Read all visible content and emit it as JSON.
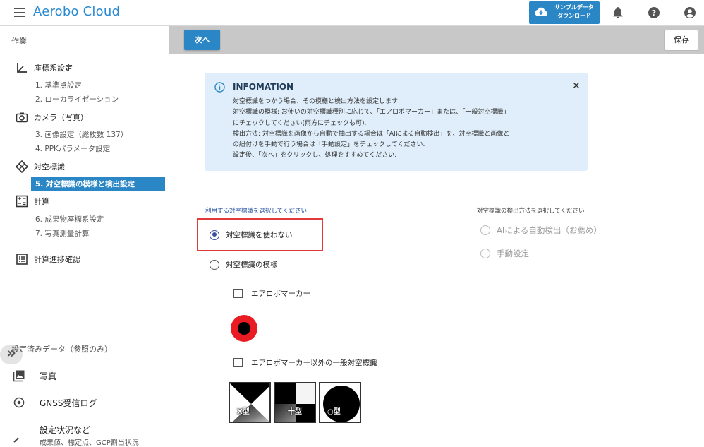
{
  "header": {
    "menu_icon": "hamburger-menu-icon",
    "app_title": "Aerobo Cloud",
    "download_button": {
      "icon": "cloud-download-icon",
      "line1": "サンプルデータ",
      "line2": "ダウンロード"
    },
    "icons": [
      "bell-icon",
      "help-icon",
      "account-icon"
    ],
    "accent_color": "#2b86c5"
  },
  "sidebar": {
    "work_title": "作業",
    "sections": [
      {
        "icon": "axis-icon",
        "label": "座標系設定",
        "items": [
          "1. 基準点設定",
          "2. ローカライゼーション"
        ]
      },
      {
        "icon": "camera-icon",
        "label": "カメラ（写真）",
        "items": [
          "3. 画像設定（総枚数 137）",
          "4. PPKパラメータ設定"
        ]
      },
      {
        "icon": "target-diamond-icon",
        "label": "対空標識",
        "active_item": "5. 対空標識の模様と検出設定"
      },
      {
        "icon": "calculator-icon",
        "label": "計算",
        "items": [
          "6. 成果物座標系設定",
          "7. 写真測量計算"
        ]
      },
      {
        "icon": "list-icon",
        "label": "計算進捗確認"
      }
    ],
    "collapse_label": "»",
    "reference_title": "設定済みデータ（参照のみ）",
    "reference_items": [
      {
        "icon": "photo-icon",
        "label": "写真"
      },
      {
        "icon": "gnss-icon",
        "label": "GNSS受信ログ"
      },
      {
        "icon": "status-icon",
        "label": "設定状況など",
        "sub": "成果値、標定点、GCP割当状況"
      }
    ]
  },
  "toolbar": {
    "next_label": "次へ",
    "save_label": "保存"
  },
  "info": {
    "icon": "info-icon",
    "title": "INFOMATION",
    "close_icon": "close-icon",
    "lines": [
      "対空標識をつかう場合、その模様と検出方法を設定します.",
      "対空標識の模様: お使いの対空標識種別に応じて、「エアロボマーカー」または、「一般対空標識」",
      "にチェックしてください(両方にチェックも可).",
      "検出方法: 対空標識を画像から自動で抽出する場合は「AIによる自動検出」を、対空標識と画像と",
      "の紐付けを手動で行う場合は「手動設定」をチェックしてください.",
      "設定後、「次へ」をクリックし、処理をすすめてください."
    ]
  },
  "target_selection": {
    "label": "利用する対空標識を選択してください",
    "options": [
      {
        "label": "対空標識を使わない",
        "selected": true
      },
      {
        "label": "対空標識の模様",
        "selected": false
      }
    ],
    "checkboxes": [
      {
        "label": "エアロボマーカー",
        "checked": false
      },
      {
        "label": "エアロボマーカー以外の一般対空標識",
        "checked": false
      }
    ],
    "marker_types": [
      "X型",
      "十型",
      "○型"
    ]
  },
  "detection_method": {
    "label": "対空標識の検出方法を選択してください",
    "options": [
      {
        "label": "AIによる自動検出（お薦め）",
        "selected": false,
        "disabled": true
      },
      {
        "label": "手動設定",
        "selected": false,
        "disabled": true
      }
    ]
  }
}
